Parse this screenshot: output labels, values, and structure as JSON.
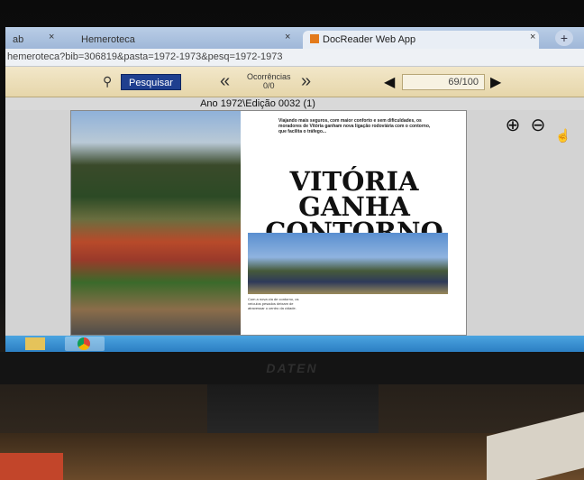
{
  "browser": {
    "tabs": [
      {
        "label": "ab"
      },
      {
        "label": "Hemeroteca"
      },
      {
        "label": "DocReader Web App"
      }
    ],
    "close_glyph": "×",
    "new_tab_glyph": "+",
    "url": "hemeroteca?bib=306819&pasta=1972-1973&pesq=1972-1973"
  },
  "toolbar": {
    "search_label": "Pesquisar",
    "search_icon": "binoculars-icon",
    "prev_occurrence": "«",
    "occurrences_label": "Ocorrências",
    "occurrences_value": "0/0",
    "next_occurrence": "»",
    "prev_page": "◀",
    "page_value": "69/100",
    "next_page": "▶"
  },
  "edition_title": "Ano 1972\\Edição 0032 (1)",
  "document": {
    "headline": "VITÓRIA GANHA CONTORNO",
    "intro_text": "Viajando mais seguros, com maior conforto e sem dificuldades, os moradores de Vitória ganham nova ligação rodoviária com o contorno, que facilita o tráfego...",
    "caption_text": "Com a nova via de contorno, os veículos pesados deixam de atravessar o centro da cidade."
  },
  "viewer": {
    "zoom_in_glyph": "⊕",
    "zoom_out_glyph": "⊖",
    "cursor_glyph": "☝"
  },
  "taskbar": {
    "items": [
      "folder-icon",
      "chrome-icon"
    ]
  },
  "monitor": {
    "brand": "DATEN"
  },
  "colors": {
    "search_button": "#1f3f8f",
    "toolbar": "#e6d6aa",
    "taskbar": "#2c7fc3"
  }
}
